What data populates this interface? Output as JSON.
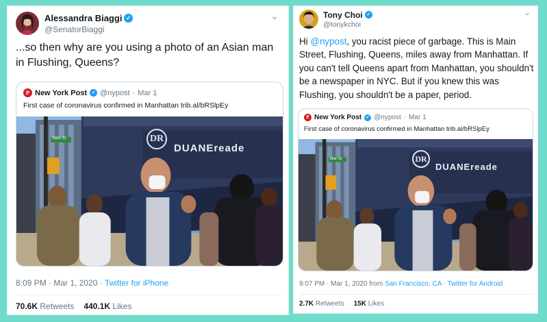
{
  "left": {
    "author": {
      "name": "Alessandra Biaggi",
      "handle": "@SenatorBiaggi"
    },
    "text": "...so then why are you using a photo of an Asian man in Flushing, Queens?",
    "quote": {
      "name": "New York Post",
      "handle": "@nypost",
      "dot": "·",
      "date": "Mar 1",
      "text": "First case of coronavirus confirmed in Manhattan trib.al/bRSlpEy"
    },
    "meta": {
      "time": "8:09 PM · Mar 1, 2020 · ",
      "source": "Twitter for iPhone"
    },
    "stats": {
      "retweets_count": "70.6K",
      "retweets_label": " Retweets",
      "likes_count": "440.1K",
      "likes_label": " Likes"
    }
  },
  "right": {
    "author": {
      "name": "Tony Choi",
      "handle": "@tonykchoi"
    },
    "text": {
      "prefix": "Hi ",
      "mention": "@nypost",
      "body": ", you racist piece of garbage. This is Main Street, Flushing, Queens, miles away from Manhattan. If you can't tell Queens apart from Manhattan, you shouldn't be a newspaper in NYC. But if you knew this was Flushing, you shouldn't be a paper, period."
    },
    "quote": {
      "name": "New York Post",
      "handle": "@nypost",
      "dot": "·",
      "date": "Mar 1",
      "text": "First case of coronavirus confirmed in Manhattan trib.al/bRSlpEy"
    },
    "meta": {
      "time": "9:07 PM · Mar 1, 2020 from ",
      "location": "San Francisco, CA",
      "mid": " · ",
      "source": "Twitter for Android"
    },
    "stats": {
      "retweets_count": "2.7K",
      "retweets_label": " Retweets",
      "likes_count": "15K",
      "likes_label": " Likes"
    }
  },
  "photo": {
    "sign_logo": "DR",
    "sign_text": "DUANEreade",
    "street_sign": "Main St"
  },
  "icons": {
    "verified": "verified-badge-icon",
    "chevron": "chevron-down-icon",
    "nyp": "nypost-logo-icon"
  },
  "colors": {
    "background": "#6fdccb",
    "link": "#1da1f2",
    "muted": "#657786",
    "nyp_red": "#d3202a"
  }
}
